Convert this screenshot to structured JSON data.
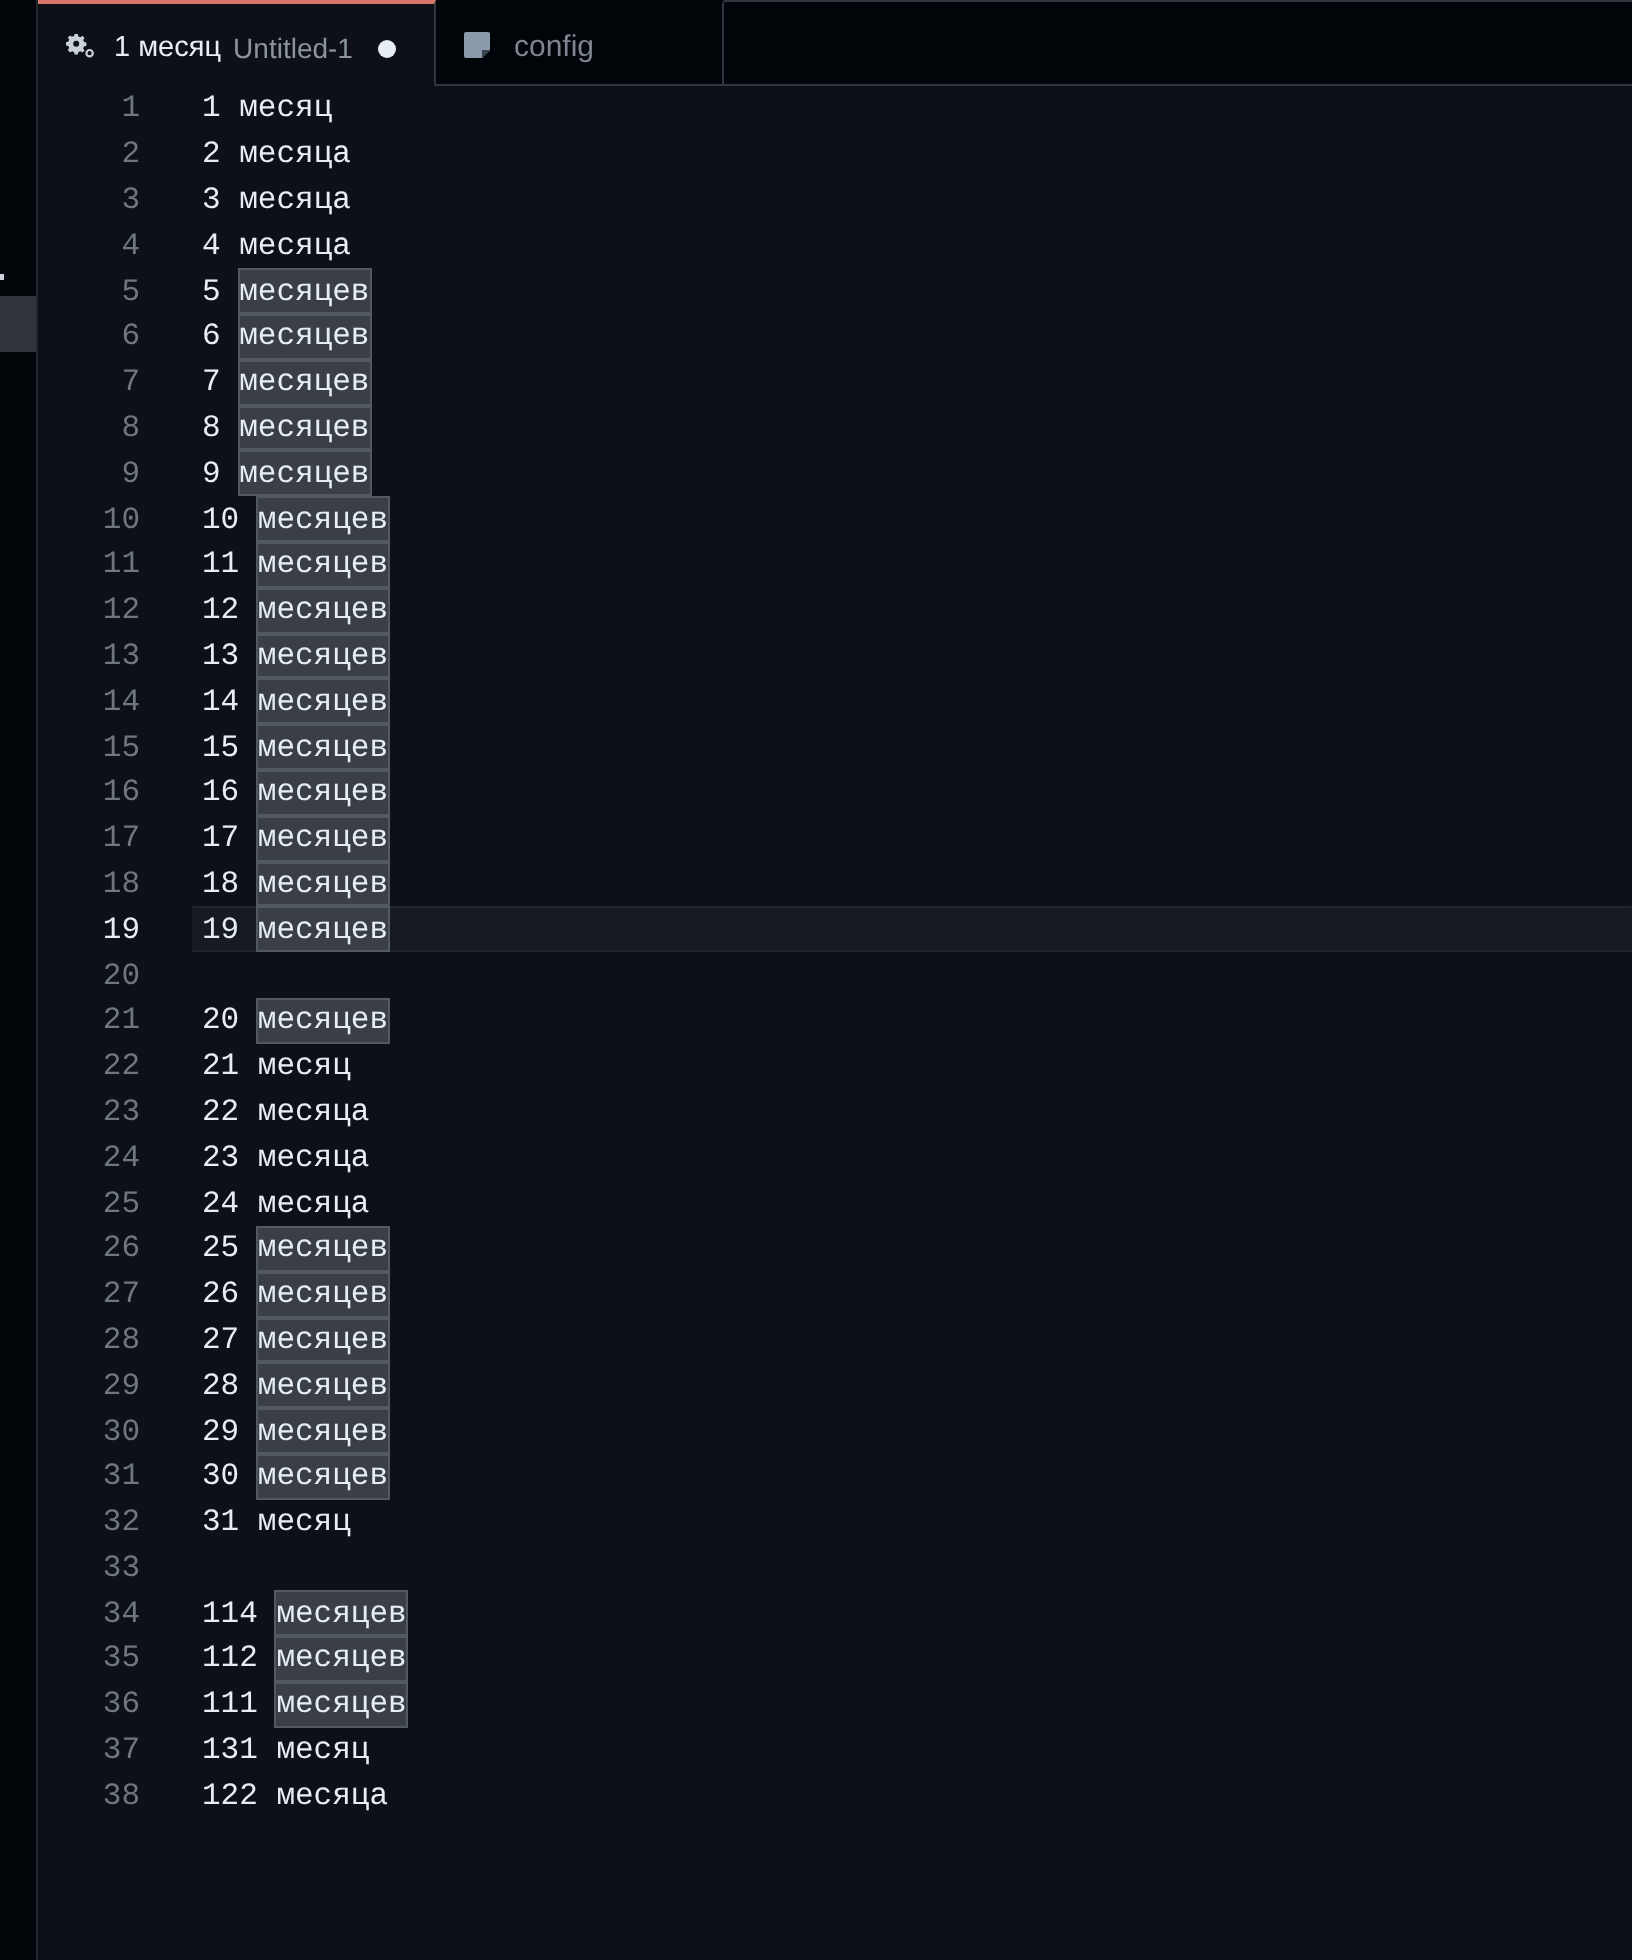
{
  "tabs": [
    {
      "kind": "settings",
      "label": "1 месяц",
      "description": "Untitled-1",
      "modified": true,
      "selected": true
    },
    {
      "kind": "document",
      "label": "config",
      "modified": false,
      "selected": false
    }
  ],
  "lines": [
    {
      "number": "1",
      "count": "1",
      "word": "месяц",
      "highlighted": false,
      "current": false
    },
    {
      "number": "2",
      "count": "2",
      "word": "месяца",
      "highlighted": false,
      "current": false
    },
    {
      "number": "3",
      "count": "3",
      "word": "месяца",
      "highlighted": false,
      "current": false
    },
    {
      "number": "4",
      "count": "4",
      "word": "месяца",
      "highlighted": false,
      "current": false
    },
    {
      "number": "5",
      "count": "5",
      "word": "месяцев",
      "highlighted": true,
      "current": false
    },
    {
      "number": "6",
      "count": "6",
      "word": "месяцев",
      "highlighted": true,
      "current": false
    },
    {
      "number": "7",
      "count": "7",
      "word": "месяцев",
      "highlighted": true,
      "current": false
    },
    {
      "number": "8",
      "count": "8",
      "word": "месяцев",
      "highlighted": true,
      "current": false
    },
    {
      "number": "9",
      "count": "9",
      "word": "месяцев",
      "highlighted": true,
      "current": false
    },
    {
      "number": "10",
      "count": "10",
      "word": "месяцев",
      "highlighted": true,
      "current": false
    },
    {
      "number": "11",
      "count": "11",
      "word": "месяцев",
      "highlighted": true,
      "current": false
    },
    {
      "number": "12",
      "count": "12",
      "word": "месяцев",
      "highlighted": true,
      "current": false
    },
    {
      "number": "13",
      "count": "13",
      "word": "месяцев",
      "highlighted": true,
      "current": false
    },
    {
      "number": "14",
      "count": "14",
      "word": "месяцев",
      "highlighted": true,
      "current": false
    },
    {
      "number": "15",
      "count": "15",
      "word": "месяцев",
      "highlighted": true,
      "current": false
    },
    {
      "number": "16",
      "count": "16",
      "word": "месяцев",
      "highlighted": true,
      "current": false
    },
    {
      "number": "17",
      "count": "17",
      "word": "месяцев",
      "highlighted": true,
      "current": false
    },
    {
      "number": "18",
      "count": "18",
      "word": "месяцев",
      "highlighted": true,
      "current": false
    },
    {
      "number": "19",
      "count": "19",
      "word": "месяцев",
      "highlighted": true,
      "current": true
    },
    {
      "number": "20",
      "current": false
    },
    {
      "number": "21",
      "count": "20",
      "word": "месяцев",
      "highlighted": true,
      "current": false
    },
    {
      "number": "22",
      "count": "21",
      "word": "месяц",
      "highlighted": false,
      "current": false
    },
    {
      "number": "23",
      "count": "22",
      "word": "месяца",
      "highlighted": false,
      "current": false
    },
    {
      "number": "24",
      "count": "23",
      "word": "месяца",
      "highlighted": false,
      "current": false
    },
    {
      "number": "25",
      "count": "24",
      "word": "месяца",
      "highlighted": false,
      "current": false
    },
    {
      "number": "26",
      "count": "25",
      "word": "месяцев",
      "highlighted": true,
      "current": false
    },
    {
      "number": "27",
      "count": "26",
      "word": "месяцев",
      "highlighted": true,
      "current": false
    },
    {
      "number": "28",
      "count": "27",
      "word": "месяцев",
      "highlighted": true,
      "current": false
    },
    {
      "number": "29",
      "count": "28",
      "word": "месяцев",
      "highlighted": true,
      "current": false
    },
    {
      "number": "30",
      "count": "29",
      "word": "месяцев",
      "highlighted": true,
      "current": false
    },
    {
      "number": "31",
      "count": "30",
      "word": "месяцев",
      "highlighted": true,
      "current": false
    },
    {
      "number": "32",
      "count": "31",
      "word": "месяц",
      "highlighted": false,
      "current": false
    },
    {
      "number": "33",
      "current": false
    },
    {
      "number": "34",
      "count": "114",
      "word": "месяцев",
      "highlighted": true,
      "current": false
    },
    {
      "number": "35",
      "count": "112",
      "word": "месяцев",
      "highlighted": true,
      "current": false
    },
    {
      "number": "36",
      "count": "111",
      "word": "месяцев",
      "highlighted": true,
      "current": false
    },
    {
      "number": "37",
      "count": "131",
      "word": "месяц",
      "highlighted": false,
      "current": false
    },
    {
      "number": "38",
      "count": "122",
      "word": "месяца",
      "highlighted": false,
      "current": false
    }
  ]
}
